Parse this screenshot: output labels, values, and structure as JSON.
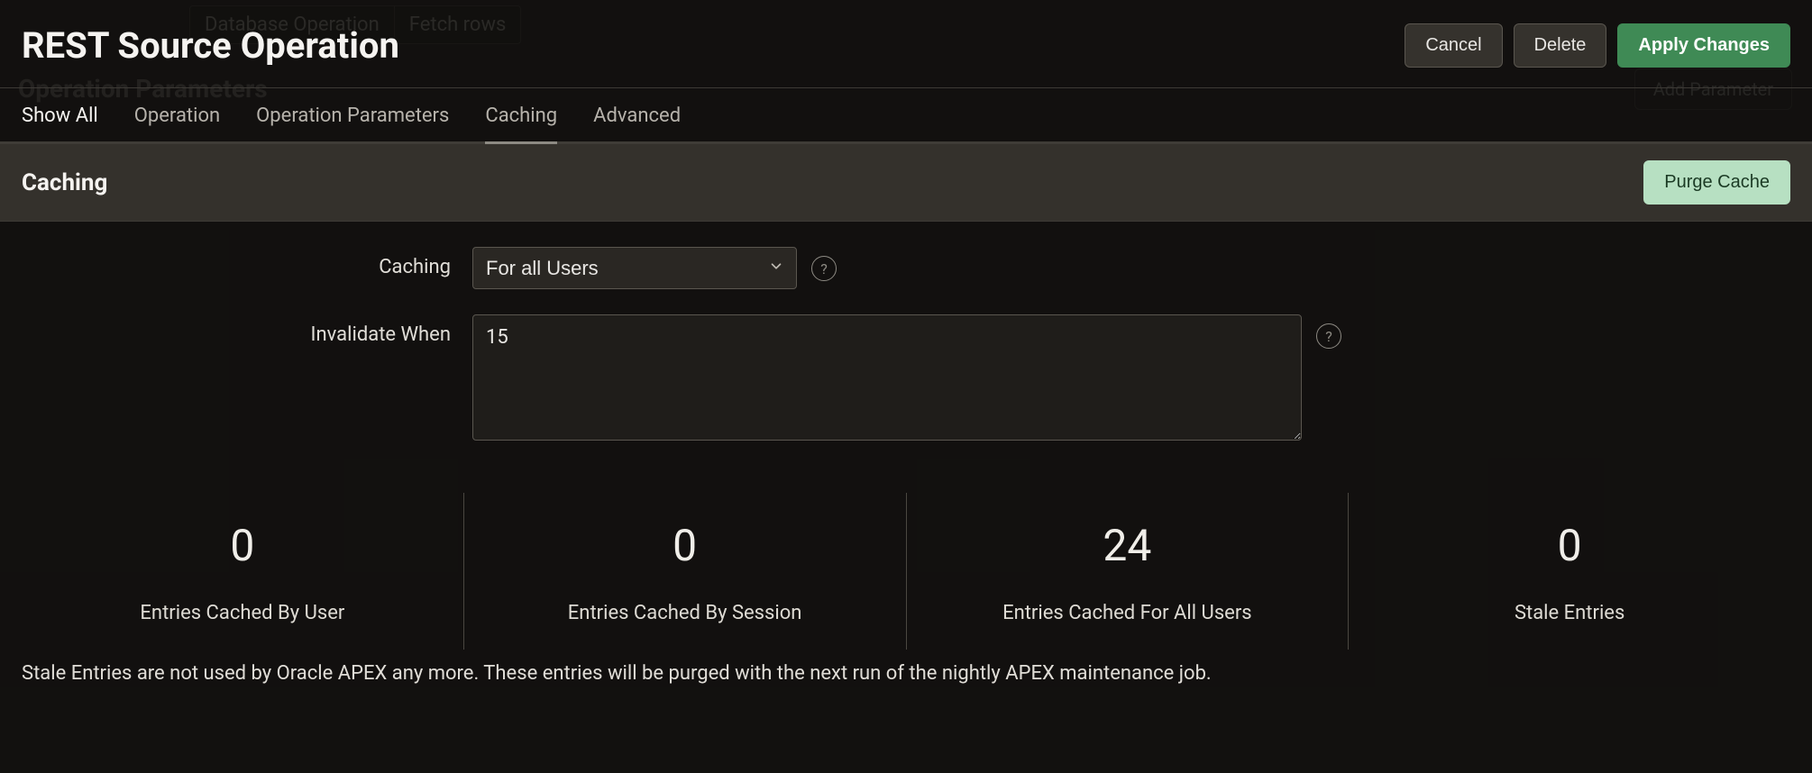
{
  "background": {
    "db_op_label": "Database Operation",
    "db_op_value": "Fetch rows",
    "section_label": "Operation Parameters",
    "add_param_label": "Add Parameter"
  },
  "header": {
    "title": "REST Source Operation",
    "cancel": "Cancel",
    "delete": "Delete",
    "apply": "Apply Changes"
  },
  "tabs": {
    "show_all": "Show All",
    "operation": "Operation",
    "operation_parameters": "Operation Parameters",
    "caching": "Caching",
    "advanced": "Advanced"
  },
  "section": {
    "title": "Caching",
    "purge": "Purge Cache"
  },
  "form": {
    "caching_label": "Caching",
    "caching_value": "For all Users",
    "invalidate_label": "Invalidate When",
    "invalidate_value": "15",
    "help_glyph": "?"
  },
  "stats": [
    {
      "value": "0",
      "label": "Entries Cached By User"
    },
    {
      "value": "0",
      "label": "Entries Cached By Session"
    },
    {
      "value": "24",
      "label": "Entries Cached For All Users"
    },
    {
      "value": "0",
      "label": "Stale Entries"
    }
  ],
  "footnote": "Stale Entries are not used by Oracle APEX any more. These entries will be purged with the next run of the nightly APEX maintenance job."
}
